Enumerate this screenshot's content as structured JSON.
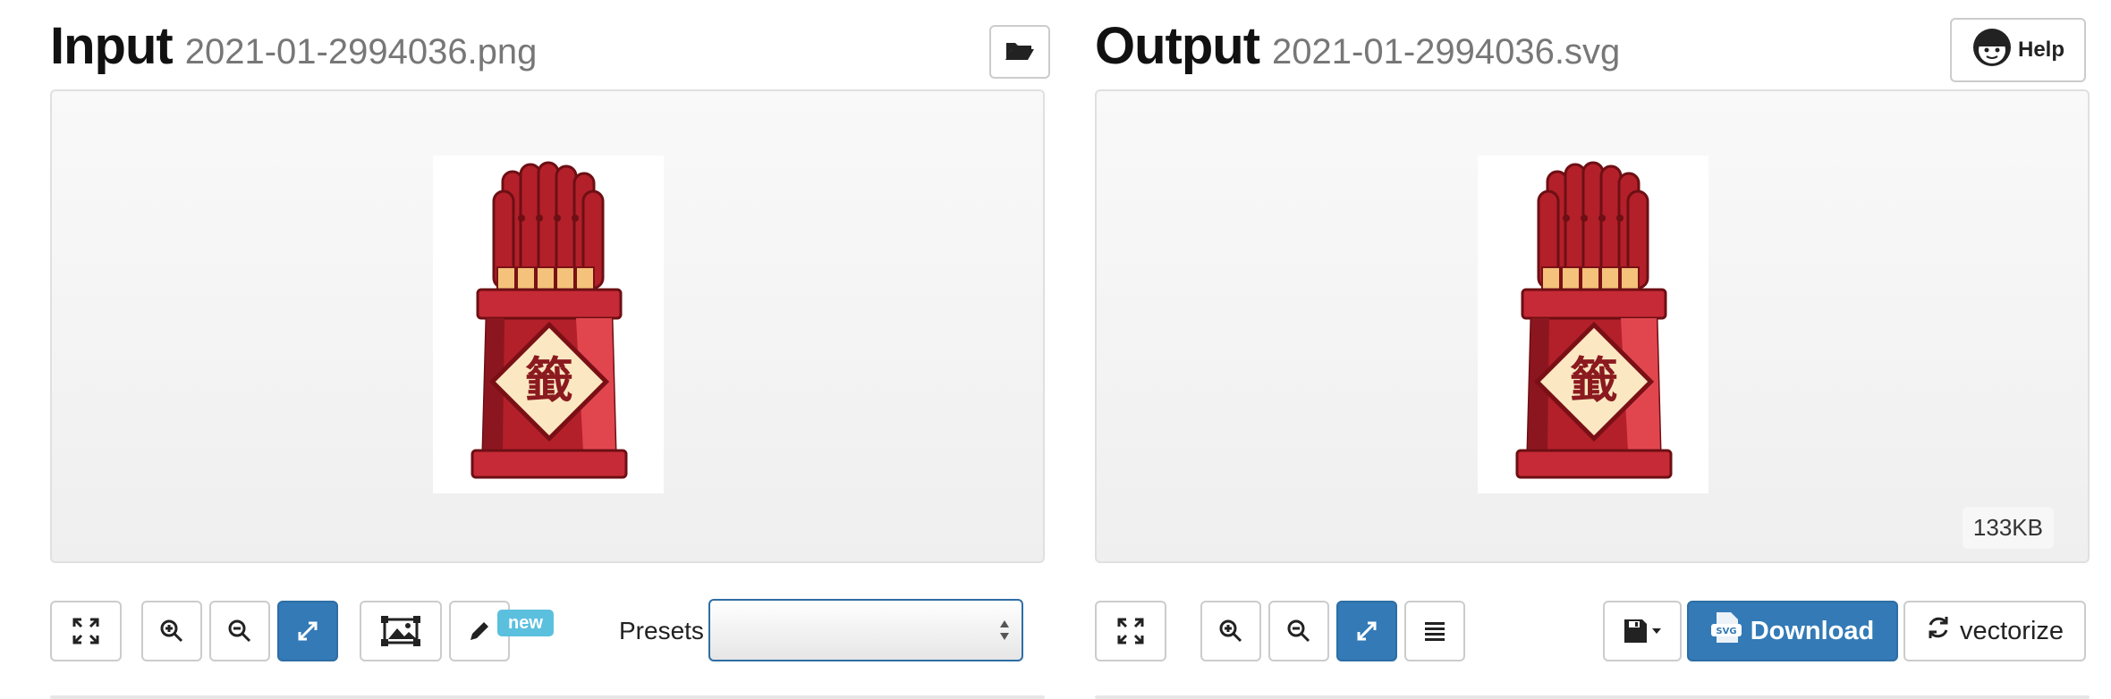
{
  "input": {
    "title": "Input",
    "filename": "2021-01-2994036.png"
  },
  "output": {
    "title": "Output",
    "filename": "2021-01-2994036.svg",
    "size_badge": "133KB"
  },
  "help": {
    "label": "Help"
  },
  "presets": {
    "label": "Presets",
    "selected": ""
  },
  "badges": {
    "new": "new"
  },
  "actions": {
    "download_label": "Download",
    "vectorize_label": "vectorize"
  },
  "image": {
    "character": "籤"
  },
  "colors": {
    "accent": "#337ab7",
    "badge_new": "#5bc0de",
    "firecracker_red": "#b3202a",
    "firecracker_dark": "#7a1016",
    "tip_gold": "#f4c27a",
    "label_cream": "#fbe8c2"
  },
  "icons": {
    "open": "folder-open-icon",
    "help": "support-agent-icon",
    "fullscreen": "fullscreen-icon",
    "zoom_in": "zoom-in-icon",
    "zoom_out": "zoom-out-icon",
    "fit": "resize-icon",
    "image": "image-crop-icon",
    "edit": "pencil-icon",
    "list": "list-icon",
    "save": "save-dropdown-icon",
    "svg": "svg-file-icon",
    "refresh": "refresh-icon"
  }
}
